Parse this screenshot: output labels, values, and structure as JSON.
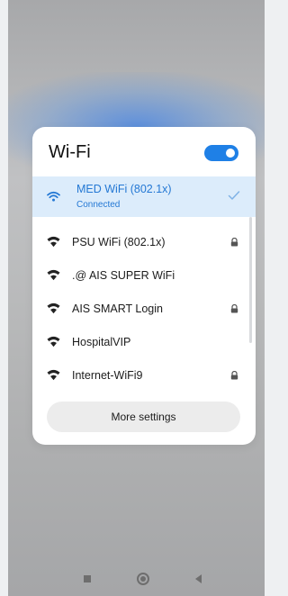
{
  "wifi_panel": {
    "title": "Wi-Fi",
    "toggle_on": true,
    "accent_color": "#1f80e6",
    "networks": [
      {
        "name": "MED WiFi (802.1x)",
        "status": "Connected",
        "secured": false,
        "connected": true,
        "icon": "wifi-icon"
      },
      {
        "name": "PSU WiFi (802.1x)",
        "secured": true,
        "connected": false,
        "icon": "wifi-icon"
      },
      {
        "name": ".@ AIS SUPER WiFi",
        "secured": false,
        "connected": false,
        "icon": "wifi-icon"
      },
      {
        "name": "AIS SMART Login",
        "secured": true,
        "connected": false,
        "icon": "wifi-icon"
      },
      {
        "name": "HospitalVIP",
        "secured": false,
        "connected": false,
        "icon": "wifi-icon"
      },
      {
        "name": "Internet-WiFi9",
        "secured": true,
        "connected": false,
        "icon": "wifi-icon"
      }
    ],
    "more_settings_label": "More settings"
  },
  "nav_bar": {
    "buttons": [
      "recents-icon",
      "home-icon",
      "back-icon"
    ]
  }
}
